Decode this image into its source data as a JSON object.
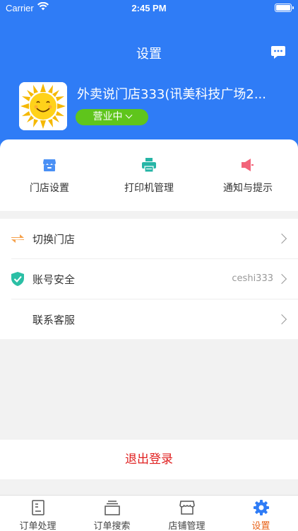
{
  "status_bar": {
    "carrier": "Carrier",
    "time": "2:45 PM"
  },
  "header": {
    "title": "设置",
    "store_name": "外卖说门店333(讯美科技广场2...",
    "store_status": "营业中",
    "background_color": "#2f7cf6",
    "status_color": "#5fc51c"
  },
  "quick_actions": [
    {
      "label": "门店设置",
      "icon": "store-settings-icon",
      "color": "#4a90f5"
    },
    {
      "label": "打印机管理",
      "icon": "printer-icon",
      "color": "#26b5a6"
    },
    {
      "label": "通知与提示",
      "icon": "speaker-icon",
      "color": "#f2647a"
    }
  ],
  "settings_list": [
    {
      "label": "切换门店",
      "icon": "switch-arrows-icon",
      "value": ""
    },
    {
      "label": "账号安全",
      "icon": "shield-check-icon",
      "value": "ceshi333"
    },
    {
      "label": "联系客服",
      "icon": "",
      "value": ""
    }
  ],
  "logout": {
    "label": "退出登录",
    "color": "#e02020"
  },
  "tabbar": {
    "active_color": "#e8641b",
    "tabs": [
      {
        "label": "订单处理",
        "icon": "order-document-icon",
        "active": false
      },
      {
        "label": "订单搜索",
        "icon": "order-stack-icon",
        "active": false
      },
      {
        "label": "店铺管理",
        "icon": "shop-icon",
        "active": false
      },
      {
        "label": "设置",
        "icon": "gear-icon",
        "active": true
      }
    ]
  }
}
